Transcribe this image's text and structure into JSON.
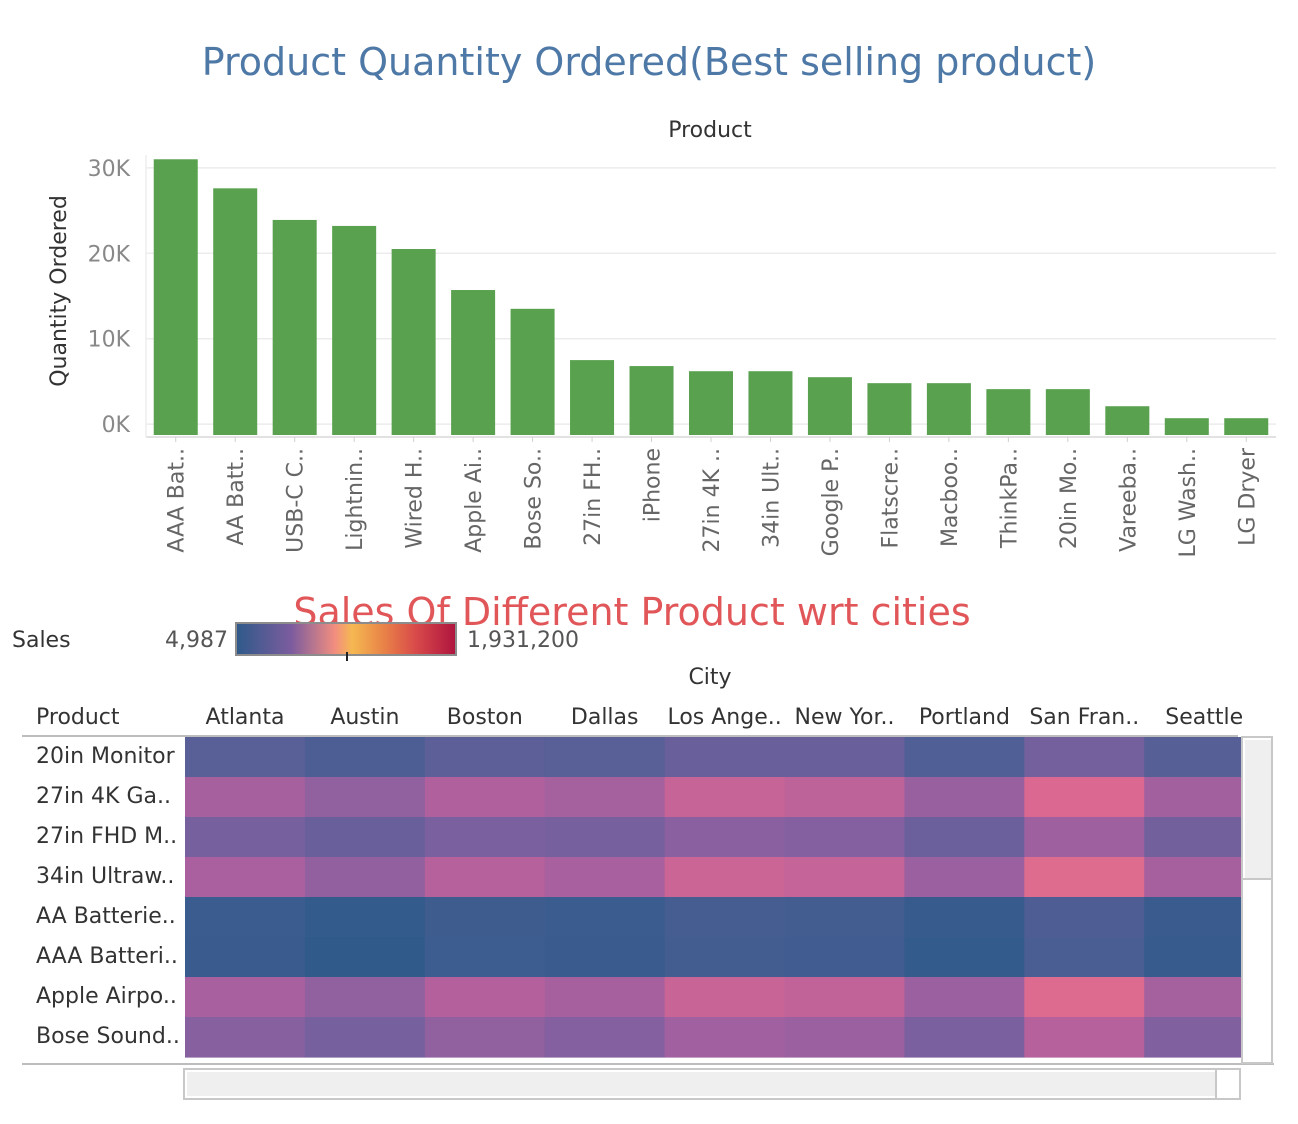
{
  "charts": {
    "bar": {
      "title": "Product Quantity Ordered(Best selling product)",
      "x_header": "Product"
    },
    "heatmap": {
      "title": "Sales Of Different Product wrt cities",
      "legend_label": "Sales",
      "legend_min": "4,987",
      "legend_max": "1,931,200",
      "column_header": "City",
      "row_header": "Product"
    }
  },
  "colors": {
    "bar": "#59a14f",
    "bar_title": "#4e79a7",
    "heat_title": "#e15759"
  },
  "chart_data": [
    {
      "type": "bar",
      "title": "Product Quantity Ordered(Best selling product)",
      "xlabel": "Product",
      "ylabel": "Quantity Ordered",
      "ylim": [
        -1500,
        31500
      ],
      "yticks": [
        0,
        10000,
        20000,
        30000
      ],
      "ytick_labels": [
        "0K",
        "10K",
        "20K",
        "30K"
      ],
      "categories": [
        "AAA Bat..",
        "AA Batt..",
        "USB-C C..",
        "Lightnin..",
        "Wired H..",
        "Apple Ai..",
        "Bose So..",
        "27in FH..",
        "iPhone",
        "27in 4K ..",
        "34in Ult..",
        "Google P..",
        "Flatscre..",
        "Macboo..",
        "ThinkPa..",
        "20in Mo..",
        "Vareeba..",
        "LG Wash..",
        "LG Dryer"
      ],
      "values": [
        31000,
        27600,
        23900,
        23200,
        20500,
        15700,
        13500,
        7500,
        6800,
        6200,
        6200,
        5500,
        4800,
        4800,
        4100,
        4100,
        2100,
        700,
        700
      ],
      "grid": true
    },
    {
      "type": "heatmap",
      "title": "Sales Of Different Product wrt cities",
      "xlabel": "City",
      "ylabel": "Product",
      "columns": [
        "Atlanta",
        "Austin",
        "Boston",
        "Dallas",
        "Los Ange..",
        "New Yor..",
        "Portland",
        "San Fran..",
        "Seattle"
      ],
      "rows": [
        "20in Monitor",
        "27in 4K Ga..",
        "27in FHD M..",
        "34in Ultraw..",
        "AA Batterie..",
        "AAA Batteri..",
        "Apple Airpo..",
        "Bose Sound.."
      ],
      "value_range": [
        4987,
        1931200
      ],
      "values": [
        [
          36000,
          20000,
          40000,
          35000,
          60000,
          60000,
          25000,
          90000,
          32000
        ],
        [
          300000,
          190000,
          370000,
          290000,
          520000,
          460000,
          230000,
          720000,
          280000
        ],
        [
          100000,
          60000,
          120000,
          100000,
          170000,
          150000,
          70000,
          260000,
          85000
        ],
        [
          320000,
          200000,
          400000,
          310000,
          560000,
          500000,
          240000,
          780000,
          300000
        ],
        [
          9000,
          6000,
          11000,
          9000,
          15000,
          14000,
          7000,
          22000,
          8000
        ],
        [
          8000,
          5000,
          10000,
          8000,
          13000,
          12000,
          6000,
          19000,
          7000
        ],
        [
          310000,
          190000,
          380000,
          300000,
          540000,
          480000,
          240000,
          760000,
          290000
        ],
        [
          160000,
          100000,
          190000,
          150000,
          270000,
          240000,
          120000,
          400000,
          140000
        ]
      ]
    }
  ]
}
